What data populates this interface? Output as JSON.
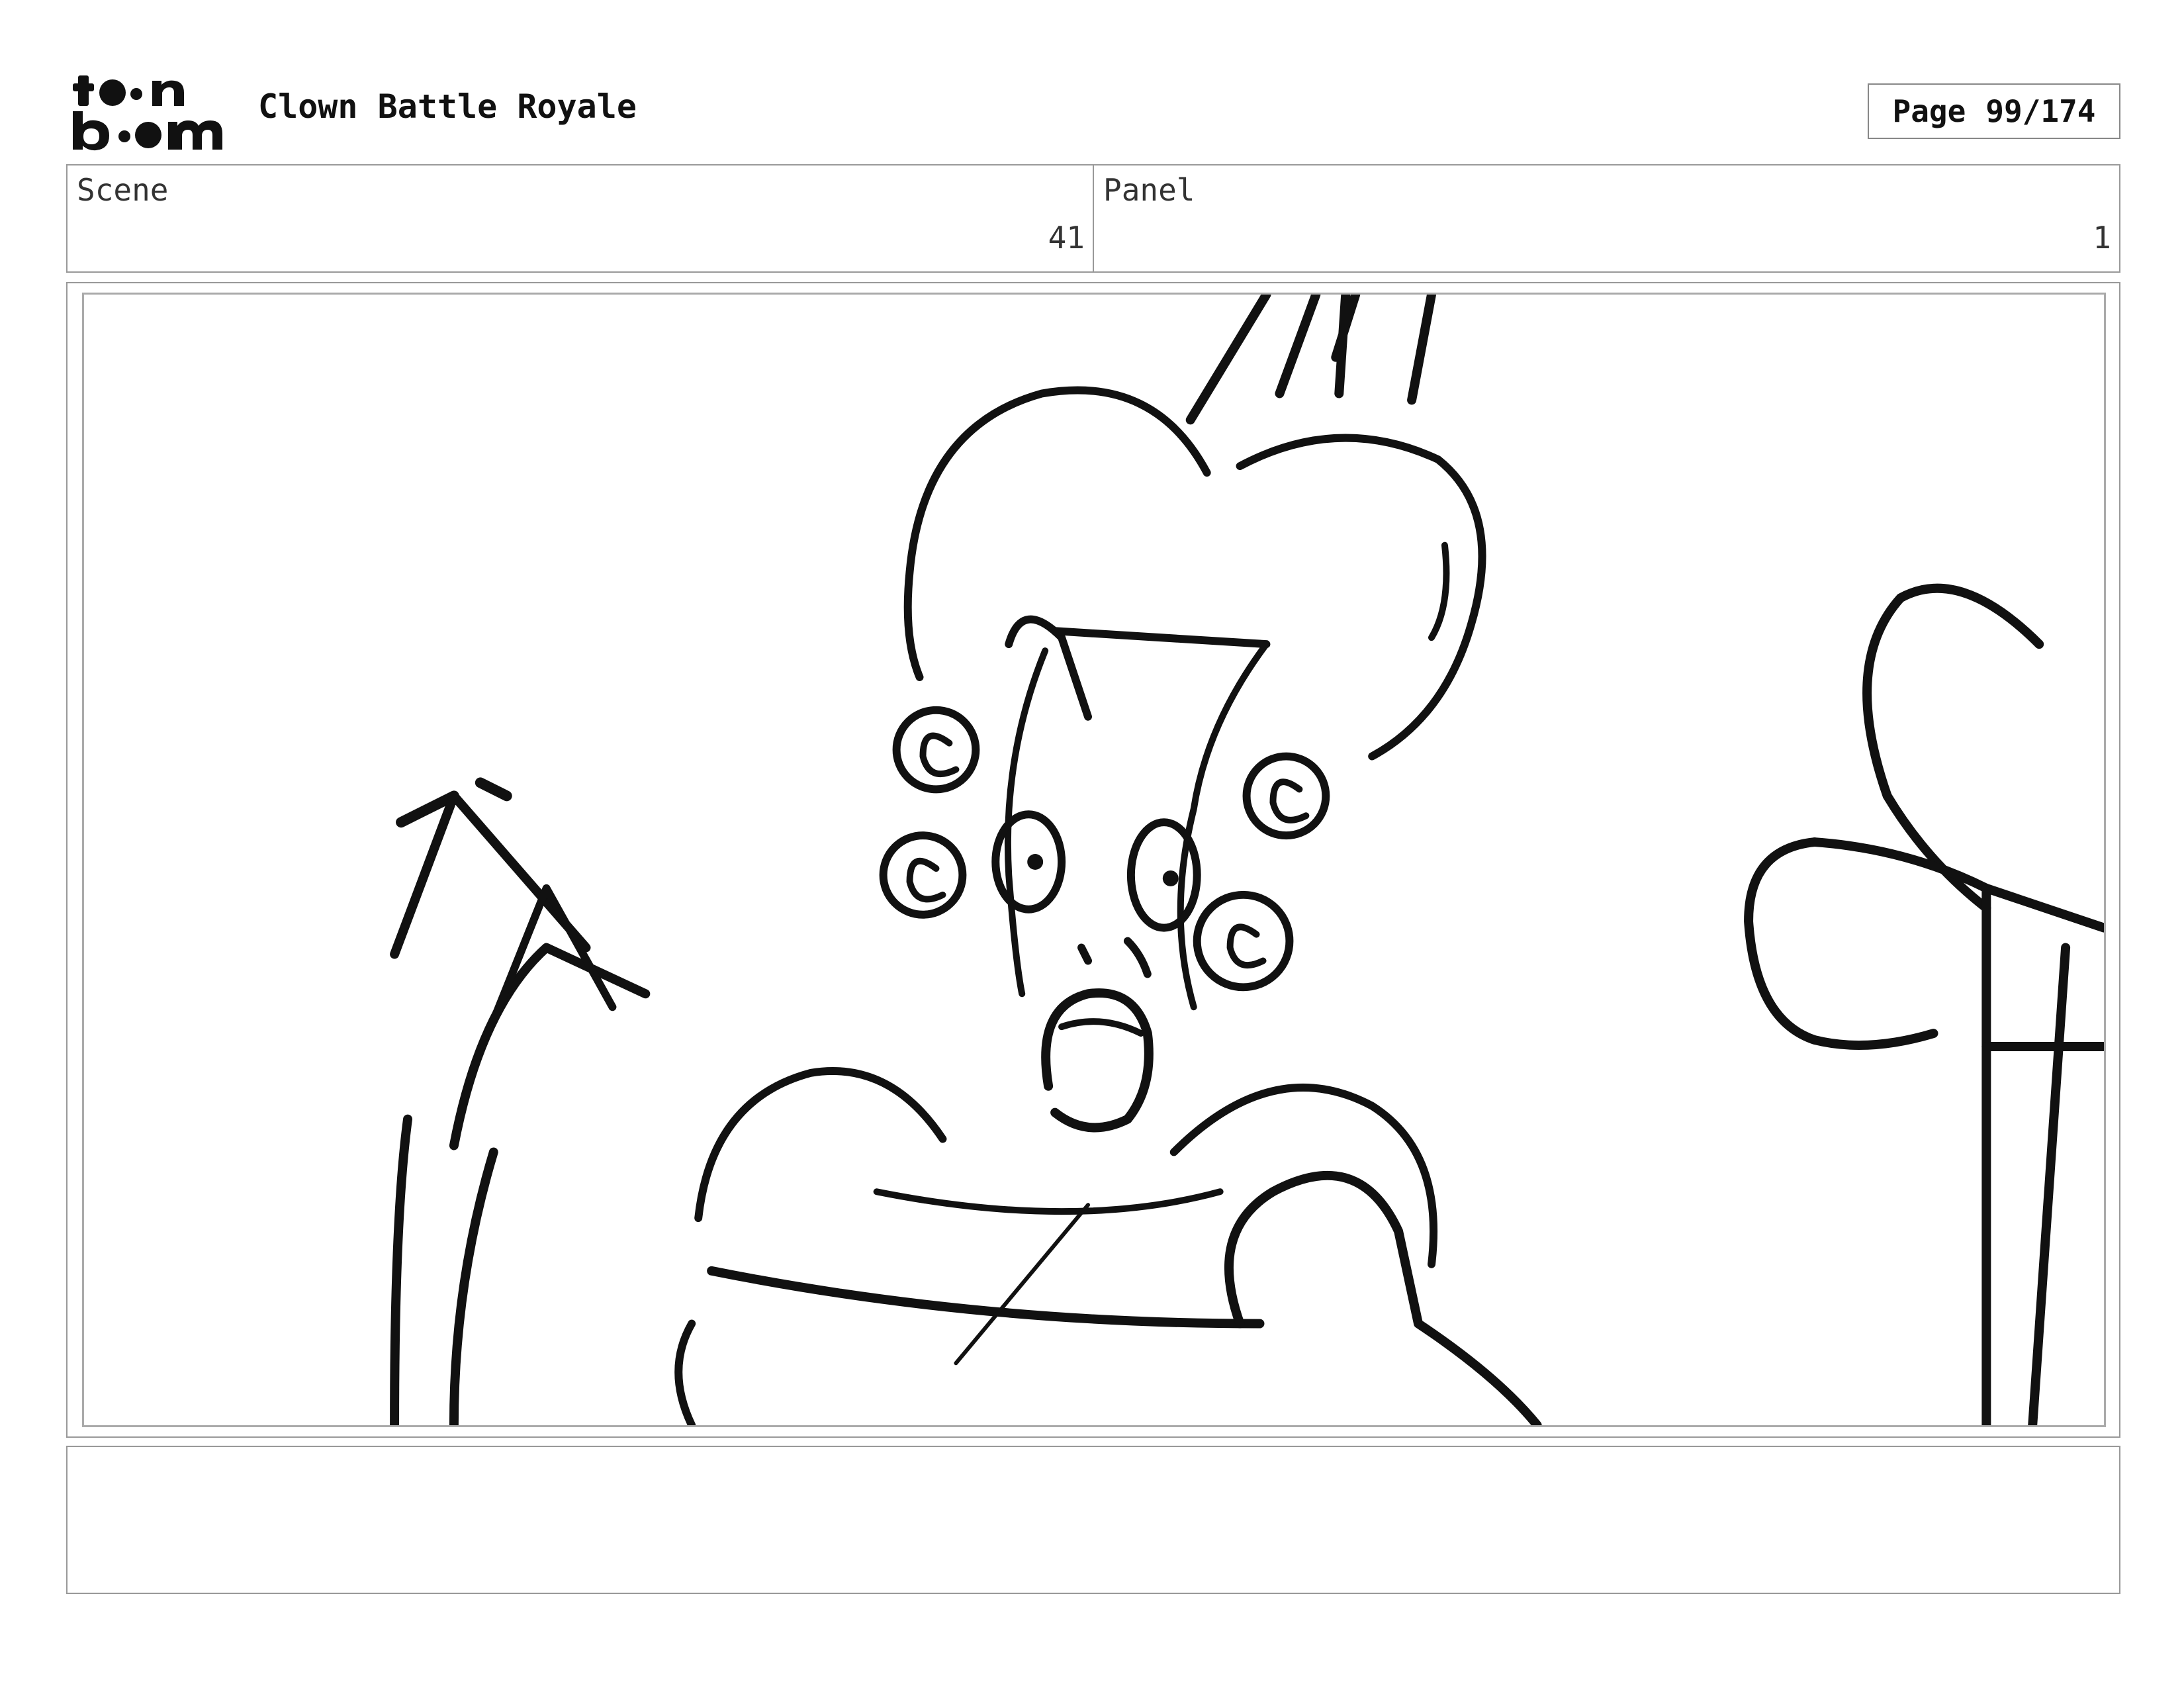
{
  "header": {
    "logo_text": "toon boom",
    "title": "Clown Battle Royale",
    "page_label": "Page",
    "page_number": "99/174"
  },
  "info": {
    "scene_label": "Scene",
    "scene_value": "41",
    "panel_label": "Panel",
    "panel_value": "1"
  },
  "notes": {
    "text": ""
  }
}
